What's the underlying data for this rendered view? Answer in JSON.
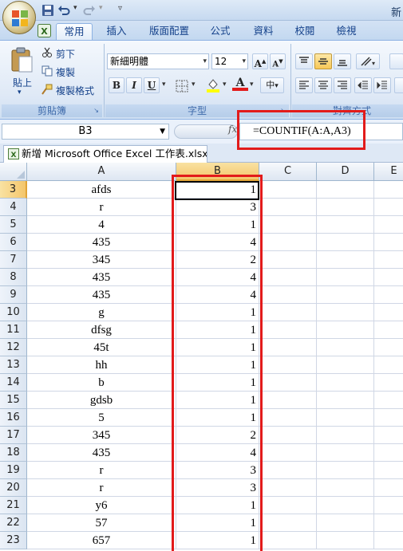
{
  "title_text": "新",
  "tabs": [
    "常用",
    "插入",
    "版面配置",
    "公式",
    "資料",
    "校閱",
    "檢視"
  ],
  "ribbon": {
    "clipboard": {
      "paste": "貼上",
      "cut": "剪下",
      "copy": "複製",
      "format_painter": "複製格式",
      "group": "剪貼簿"
    },
    "font": {
      "font_name": "新細明體",
      "font_size": "12",
      "bold": "B",
      "italic": "I",
      "underline": "U",
      "group": "字型"
    },
    "alignment": {
      "group": "對齊方式"
    }
  },
  "formula_bar": {
    "name_box": "B3",
    "fx": "fx",
    "formula": "=COUNTIF(A:A,A3)"
  },
  "doc_tab": "新增 Microsoft Office Excel 工作表.xlsx *",
  "columns": [
    "A",
    "B",
    "C",
    "D",
    "E"
  ],
  "rows": [
    {
      "n": "3",
      "a": "afds",
      "b": "1"
    },
    {
      "n": "4",
      "a": "r",
      "b": "3"
    },
    {
      "n": "5",
      "a": "4",
      "b": "1"
    },
    {
      "n": "6",
      "a": "435",
      "b": "4"
    },
    {
      "n": "7",
      "a": "345",
      "b": "2"
    },
    {
      "n": "8",
      "a": "435",
      "b": "4"
    },
    {
      "n": "9",
      "a": "435",
      "b": "4"
    },
    {
      "n": "10",
      "a": "g",
      "b": "1"
    },
    {
      "n": "11",
      "a": "dfsg",
      "b": "1"
    },
    {
      "n": "12",
      "a": "45t",
      "b": "1"
    },
    {
      "n": "13",
      "a": "hh",
      "b": "1"
    },
    {
      "n": "14",
      "a": "b",
      "b": "1"
    },
    {
      "n": "15",
      "a": "gdsb",
      "b": "1"
    },
    {
      "n": "16",
      "a": "5",
      "b": "1"
    },
    {
      "n": "17",
      "a": "345",
      "b": "2"
    },
    {
      "n": "18",
      "a": "435",
      "b": "4"
    },
    {
      "n": "19",
      "a": "r",
      "b": "3"
    },
    {
      "n": "20",
      "a": "r",
      "b": "3"
    },
    {
      "n": "21",
      "a": "y6",
      "b": "1"
    },
    {
      "n": "22",
      "a": "57",
      "b": "1"
    },
    {
      "n": "23",
      "a": "657",
      "b": "1"
    }
  ],
  "colors": {
    "highlight": "#e21b1b",
    "selected_header": "#f4c66b"
  }
}
